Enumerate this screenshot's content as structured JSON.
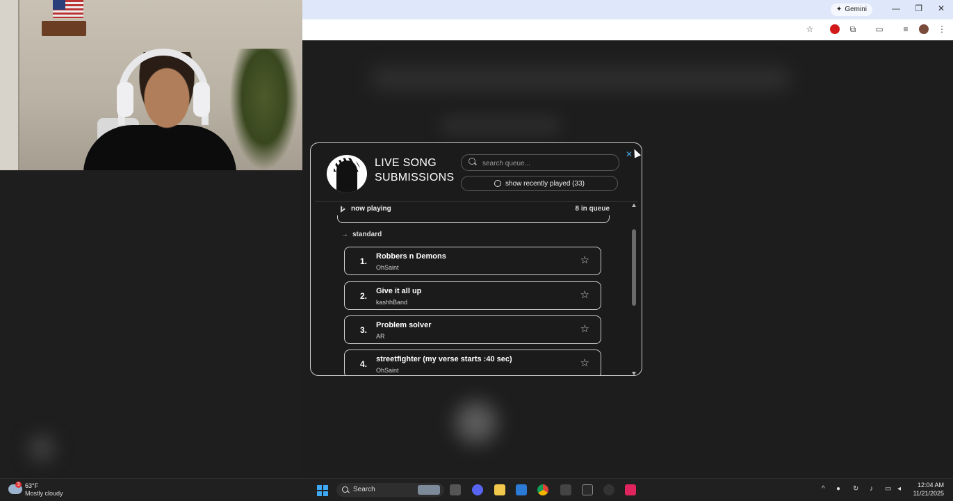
{
  "browser": {
    "gemini_label": "Gemini",
    "window_controls": {
      "minimize": "—",
      "restore": "❐",
      "close": "✕"
    }
  },
  "modal": {
    "title_line1": "LIVE SONG",
    "title_line2": "SUBMISSIONS",
    "search_placeholder": "search queue...",
    "recent_button_label": "show recently played (33)",
    "close_label": "✕",
    "now_playing_label": "now playing",
    "queue_count": "8 in queue",
    "section_label": "standard",
    "songs": [
      {
        "num": "1.",
        "title": "Robbers n Demons",
        "artist": "OhSaint"
      },
      {
        "num": "2.",
        "title": "Give it all up",
        "artist": "kashhBand"
      },
      {
        "num": "3.",
        "title": "Problem solver",
        "artist": "AR"
      },
      {
        "num": "4.",
        "title": "streetfighter (my verse starts :40 sec)",
        "artist": "OhSaint"
      }
    ]
  },
  "taskbar": {
    "weather_temp": "63°F",
    "weather_desc": "Mostly cloudy",
    "weather_badge": "3",
    "search_label": "Search",
    "time": "12:04 AM",
    "date": "11/21/2025"
  },
  "icons": {
    "star": "☆",
    "arrow": "→",
    "bookmark_star": "☆",
    "extensions": "⧉",
    "menu": "⋮"
  },
  "colors": {
    "modal_bg": "#1b1b1b",
    "modal_border": "#cfcfcf",
    "browser_tab_bar": "#dfe8fb",
    "close_accent": "#4aa3d8"
  }
}
